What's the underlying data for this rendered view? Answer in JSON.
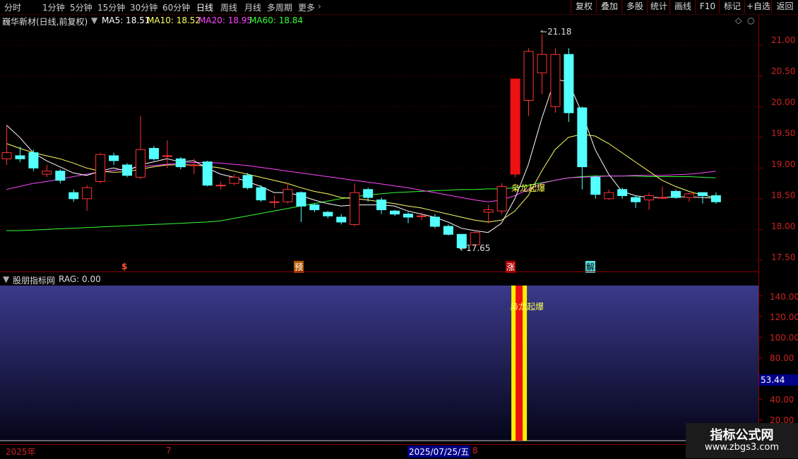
{
  "toolbar": {
    "periods": [
      "分时",
      "1分钟",
      "5分钟",
      "15分钟",
      "30分钟",
      "60分钟",
      "日线",
      "周线",
      "月线",
      "多周期",
      "更多"
    ],
    "active_index": 6,
    "buttons": [
      "复权",
      "叠加",
      "多股",
      "统计",
      "画线",
      "F10",
      "标记",
      "+自选",
      "返回"
    ]
  },
  "header": {
    "stock": "巍华新材(日线,前复权)",
    "ma5": "MA5: 18.51",
    "ma10": "MA10: 18.52",
    "ma20": "MA20: 18.95",
    "ma60": "MA60: 18.84"
  },
  "colors": {
    "up": "#ff3333",
    "down": "#54ffff",
    "ma5": "#ffffff",
    "ma10": "#ffff66",
    "ma20": "#ff44ff",
    "ma60": "#33ff33",
    "accent": "#000088"
  },
  "indicator": {
    "title": "股朋指标网",
    "value": "RAG: 0.00",
    "signal_label": "枭龙起爆",
    "current_value": "53.44",
    "axis_labels": [
      "140.00",
      "120.00",
      "100.00",
      "80.00",
      "40.00",
      "20.00"
    ]
  },
  "main_chart": {
    "signal_label": "枭龙起爆",
    "high_label": "21.18",
    "low_label": "17.65",
    "axis_labels": [
      "21.00",
      "20.50",
      "20.00",
      "19.50",
      "19.00",
      "18.50",
      "18.00",
      "17.50"
    ],
    "markers": [
      "$",
      "预",
      "涨",
      "解"
    ]
  },
  "datebar": {
    "year": "2025年",
    "m7": "7",
    "cursor_date": "2025/07/25/五",
    "m8": "8"
  },
  "watermark": {
    "line1": "指标公式网",
    "line2": "www.zbgs3.com"
  },
  "chart_data": {
    "type": "candlestick",
    "ylim": [
      17.35,
      21.3
    ],
    "candles": [
      {
        "o": 19.15,
        "c": 19.25,
        "h": 19.7,
        "l": 19.05
      },
      {
        "o": 19.2,
        "c": 19.15,
        "h": 19.35,
        "l": 19.1
      },
      {
        "o": 19.25,
        "c": 19.0,
        "h": 19.3,
        "l": 18.95
      },
      {
        "o": 18.9,
        "c": 18.95,
        "h": 19.05,
        "l": 18.85
      },
      {
        "o": 18.95,
        "c": 18.8,
        "h": 18.98,
        "l": 18.75
      },
      {
        "o": 18.6,
        "c": 18.5,
        "h": 18.65,
        "l": 18.45
      },
      {
        "o": 18.5,
        "c": 18.68,
        "h": 18.72,
        "l": 18.3
      },
      {
        "o": 18.78,
        "c": 19.22,
        "h": 19.25,
        "l": 18.75
      },
      {
        "o": 19.2,
        "c": 19.12,
        "h": 19.25,
        "l": 19.05
      },
      {
        "o": 19.05,
        "c": 18.88,
        "h": 19.08,
        "l": 18.85
      },
      {
        "o": 18.85,
        "c": 19.3,
        "h": 19.85,
        "l": 18.82
      },
      {
        "o": 19.32,
        "c": 19.15,
        "h": 19.36,
        "l": 19.12
      },
      {
        "o": 19.2,
        "c": 19.2,
        "h": 19.45,
        "l": 19.0
      },
      {
        "o": 19.15,
        "c": 19.02,
        "h": 19.18,
        "l": 18.98
      },
      {
        "o": 19.05,
        "c": 19.05,
        "h": 19.15,
        "l": 18.9
      },
      {
        "o": 19.1,
        "c": 18.72,
        "h": 19.12,
        "l": 18.7
      },
      {
        "o": 18.72,
        "c": 18.72,
        "h": 18.78,
        "l": 18.65
      },
      {
        "o": 18.75,
        "c": 18.85,
        "h": 18.9,
        "l": 18.72
      },
      {
        "o": 18.88,
        "c": 18.68,
        "h": 18.92,
        "l": 18.65
      },
      {
        "o": 18.68,
        "c": 18.48,
        "h": 18.72,
        "l": 18.45
      },
      {
        "o": 18.45,
        "c": 18.45,
        "h": 18.55,
        "l": 18.35
      },
      {
        "o": 18.45,
        "c": 18.65,
        "h": 18.75,
        "l": 18.42
      },
      {
        "o": 18.6,
        "c": 18.38,
        "h": 18.62,
        "l": 18.12
      },
      {
        "o": 18.4,
        "c": 18.32,
        "h": 18.42,
        "l": 18.28
      },
      {
        "o": 18.28,
        "c": 18.22,
        "h": 18.3,
        "l": 18.18
      },
      {
        "o": 18.2,
        "c": 18.12,
        "h": 18.25,
        "l": 18.08
      },
      {
        "o": 18.08,
        "c": 18.6,
        "h": 18.75,
        "l": 18.05
      },
      {
        "o": 18.65,
        "c": 18.52,
        "h": 18.68,
        "l": 18.45
      },
      {
        "o": 18.48,
        "c": 18.32,
        "h": 18.52,
        "l": 18.25
      },
      {
        "o": 18.3,
        "c": 18.25,
        "h": 18.32,
        "l": 18.22
      },
      {
        "o": 18.25,
        "c": 18.2,
        "h": 18.28,
        "l": 18.1
      },
      {
        "o": 18.22,
        "c": 18.22,
        "h": 18.28,
        "l": 18.15
      },
      {
        "o": 18.2,
        "c": 18.05,
        "h": 18.25,
        "l": 18.02
      },
      {
        "o": 18.05,
        "c": 17.92,
        "h": 18.08,
        "l": 17.9
      },
      {
        "o": 17.92,
        "c": 17.7,
        "h": 17.92,
        "l": 17.65
      },
      {
        "o": 17.75,
        "c": 17.95,
        "h": 17.98,
        "l": 17.72
      },
      {
        "o": 18.28,
        "c": 18.32,
        "h": 18.4,
        "l": 18.1
      },
      {
        "o": 18.3,
        "c": 18.7,
        "h": 18.75,
        "l": 18.25
      },
      {
        "o": 18.9,
        "c": 20.45,
        "h": 20.45,
        "l": 18.85
      },
      {
        "o": 20.1,
        "c": 20.9,
        "h": 20.95,
        "l": 19.85
      },
      {
        "o": 20.55,
        "c": 20.85,
        "h": 21.18,
        "l": 20.2
      },
      {
        "o": 20.0,
        "c": 20.85,
        "h": 20.95,
        "l": 19.9
      },
      {
        "o": 20.85,
        "c": 19.9,
        "h": 20.95,
        "l": 19.75
      },
      {
        "o": 19.98,
        "c": 19.02,
        "h": 20.0,
        "l": 18.65
      },
      {
        "o": 18.85,
        "c": 18.57,
        "h": 18.88,
        "l": 18.5
      },
      {
        "o": 18.5,
        "c": 18.6,
        "h": 18.65,
        "l": 18.48
      },
      {
        "o": 18.65,
        "c": 18.55,
        "h": 18.68,
        "l": 18.5
      },
      {
        "o": 18.52,
        "c": 18.45,
        "h": 18.55,
        "l": 18.35
      },
      {
        "o": 18.48,
        "c": 18.55,
        "h": 18.6,
        "l": 18.32
      },
      {
        "o": 18.52,
        "c": 18.52,
        "h": 18.7,
        "l": 18.5
      },
      {
        "o": 18.62,
        "c": 18.52,
        "h": 18.65,
        "l": 18.5
      },
      {
        "o": 18.52,
        "c": 18.58,
        "h": 18.6,
        "l": 18.45
      },
      {
        "o": 18.6,
        "c": 18.55,
        "h": 18.6,
        "l": 18.42
      },
      {
        "o": 18.55,
        "c": 18.45,
        "h": 18.6,
        "l": 18.42
      }
    ],
    "ma5": [
      19.7,
      19.5,
      19.25,
      19.12,
      19.02,
      18.92,
      18.88,
      18.95,
      19.0,
      18.95,
      19.05,
      19.1,
      19.15,
      19.1,
      19.12,
      19.0,
      18.9,
      18.85,
      18.78,
      18.7,
      18.6,
      18.6,
      18.55,
      18.48,
      18.42,
      18.38,
      18.4,
      18.4,
      18.4,
      18.38,
      18.3,
      18.25,
      18.2,
      18.12,
      18.02,
      17.98,
      17.95,
      18.1,
      18.5,
      19.05,
      19.8,
      20.45,
      20.4,
      19.9,
      19.3,
      18.9,
      18.62,
      18.55,
      18.52,
      18.52,
      18.53,
      18.53,
      18.52,
      18.51
    ],
    "ma10": [
      19.4,
      19.32,
      19.25,
      19.2,
      19.15,
      19.08,
      19.0,
      18.95,
      18.93,
      18.94,
      18.98,
      19.02,
      19.05,
      19.05,
      19.05,
      19.03,
      19.0,
      18.95,
      18.9,
      18.85,
      18.8,
      18.75,
      18.68,
      18.62,
      18.58,
      18.52,
      18.5,
      18.48,
      18.45,
      18.42,
      18.38,
      18.35,
      18.3,
      18.25,
      18.2,
      18.15,
      18.12,
      18.15,
      18.3,
      18.55,
      18.95,
      19.3,
      19.5,
      19.55,
      19.52,
      19.4,
      19.25,
      19.1,
      18.95,
      18.8,
      18.7,
      18.62,
      18.56,
      18.52
    ],
    "ma20": [
      18.65,
      18.7,
      18.75,
      18.78,
      18.82,
      18.86,
      18.9,
      18.93,
      18.96,
      18.99,
      19.02,
      19.04,
      19.06,
      19.08,
      19.09,
      19.09,
      19.08,
      19.06,
      19.04,
      19.01,
      18.98,
      18.95,
      18.92,
      18.89,
      18.86,
      18.83,
      18.8,
      18.77,
      18.74,
      18.71,
      18.68,
      18.64,
      18.6,
      18.56,
      18.52,
      18.48,
      18.45,
      18.48,
      18.55,
      18.65,
      18.75,
      18.8,
      18.84,
      18.85,
      18.86,
      18.87,
      18.87,
      18.88,
      18.88,
      18.88,
      18.89,
      18.9,
      18.92,
      18.95
    ],
    "ma60": [
      17.98,
      17.98,
      17.99,
      18.0,
      18.01,
      18.02,
      18.03,
      18.04,
      18.05,
      18.06,
      18.07,
      18.08,
      18.09,
      18.1,
      18.11,
      18.12,
      18.14,
      18.18,
      18.22,
      18.26,
      18.3,
      18.34,
      18.38,
      18.42,
      18.46,
      18.5,
      18.53,
      18.56,
      18.58,
      18.6,
      18.61,
      18.62,
      18.63,
      18.64,
      18.65,
      18.65,
      18.66,
      18.66,
      18.68,
      18.72,
      18.76,
      18.8,
      18.84,
      18.86,
      18.87,
      18.87,
      18.87,
      18.87,
      18.86,
      18.86,
      18.86,
      18.86,
      18.85,
      18.84
    ],
    "signal_index": 38
  }
}
